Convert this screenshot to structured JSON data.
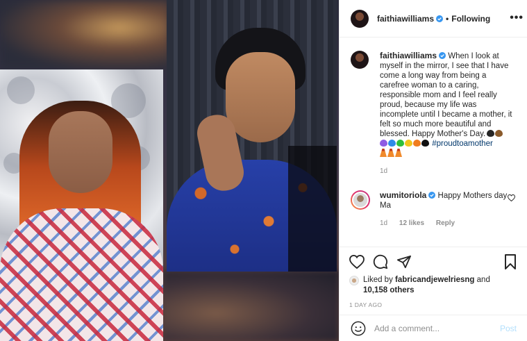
{
  "post": {
    "author": "faithiawilliams",
    "follow_status": "Following",
    "more_label": "•••"
  },
  "caption": {
    "author": "faithiawilliams",
    "text": "When I look at myself in the mirror, I see that I have come a long way from being a carefree woman to a caring, responsible mom and I feel really proud, because my life was incomplete until I became a mother, it felt so much more beautiful and blessed. Happy Mother's Day.",
    "hashtag": "#proudtoamother",
    "heart_colors": [
      "#262626",
      "#8a5a2b",
      "#8f5be3",
      "#2f8be8",
      "#2fbf3a",
      "#f0c51c",
      "#f07d1e",
      "#111111"
    ],
    "age": "1d"
  },
  "reply": {
    "author": "wumitoriola",
    "text": "Happy Mothers day Ma",
    "age": "1d",
    "likes": "12 likes",
    "reply_label": "Reply"
  },
  "likes": {
    "prefix": "Liked by",
    "user": "fabricandjewelriesng",
    "joiner": "and",
    "others": "10,158 others"
  },
  "timestamp": "1 DAY AGO",
  "comment_box": {
    "placeholder": "Add a comment...",
    "post_label": "Post"
  },
  "colors": {
    "verified": "#3897f0",
    "link": "#00376b",
    "post_button": "#b2dffc",
    "muted": "#8e8e8e"
  }
}
